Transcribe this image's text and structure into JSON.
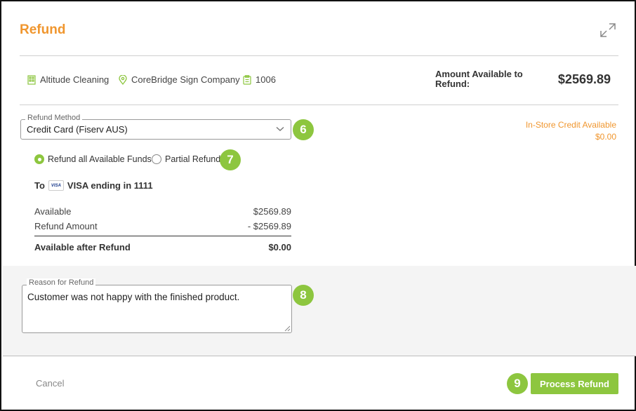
{
  "modal": {
    "title": "Refund"
  },
  "info": {
    "customer": "Altitude Cleaning",
    "company": "CoreBridge Sign Company",
    "order_number": "1006"
  },
  "amount_available": {
    "label": "Amount Available to Refund:",
    "value": "$2569.89"
  },
  "refund_method": {
    "label": "Refund Method",
    "selected": "Credit Card (Fiserv AUS)"
  },
  "in_store_credit": {
    "label": "In-Store Credit Available",
    "value": "$0.00"
  },
  "radio_options": [
    {
      "label": "Refund all Available Funds",
      "selected": true
    },
    {
      "label": "Partial Refund",
      "selected": false
    }
  ],
  "destination": {
    "prefix": "To",
    "card_brand": "VISA",
    "text": "VISA ending in 1111"
  },
  "summary": {
    "available_label": "Available",
    "available_value": "$2569.89",
    "refund_label": "Refund Amount",
    "refund_value": "- $2569.89",
    "after_label": "Available after Refund",
    "after_value": "$0.00"
  },
  "reason": {
    "label": "Reason for Refund",
    "value": "Customer was not happy with the finished product."
  },
  "badges": {
    "method": "6",
    "radio": "7",
    "reason": "8",
    "process": "9"
  },
  "footer": {
    "cancel_label": "Cancel",
    "process_label": "Process Refund"
  },
  "colors": {
    "accent_orange": "#f0962e",
    "accent_green": "#8dc63f"
  }
}
